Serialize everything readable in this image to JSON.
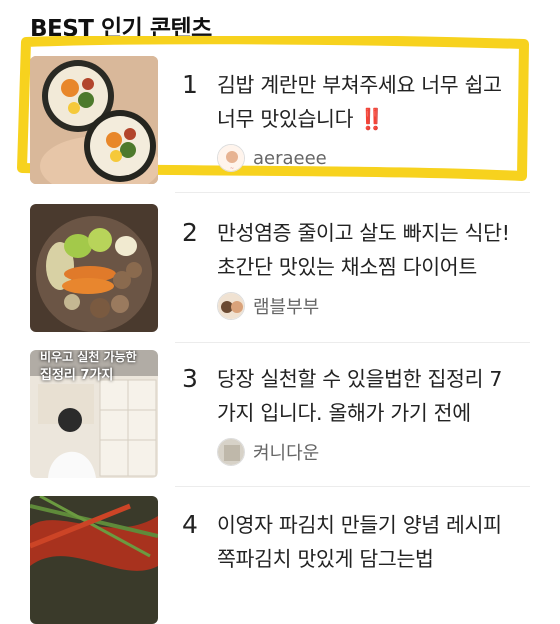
{
  "section": {
    "title": "BEST 인기 콘텐츠"
  },
  "items": [
    {
      "rank": "1",
      "title": "김밥 계란만 부쳐주세요 너무 쉽고 너무 맛있습니다",
      "emphasis": "‼️",
      "author": "aeraeee"
    },
    {
      "rank": "2",
      "title": "만성염증 줄이고 살도 빠지는 식단! 초간단 맛있는 채소찜 다이어트",
      "emphasis": "",
      "author": "램블부부"
    },
    {
      "rank": "3",
      "title": "당장 실천할 수 있을법한 집정리 7가지 입니다. 올해가 가기 전에",
      "emphasis": "",
      "author": "켜니다운",
      "thumb_text": [
        "비우고 실천 가능한",
        "집정리 7가지"
      ]
    },
    {
      "rank": "4",
      "title": "이영자 파김치 만들기 양념 레시피 쪽파김치 맛있게 담그는법",
      "emphasis": "",
      "author": ""
    }
  ],
  "colors": {
    "highlight": "#f7d21e",
    "excl": "#e11111"
  }
}
